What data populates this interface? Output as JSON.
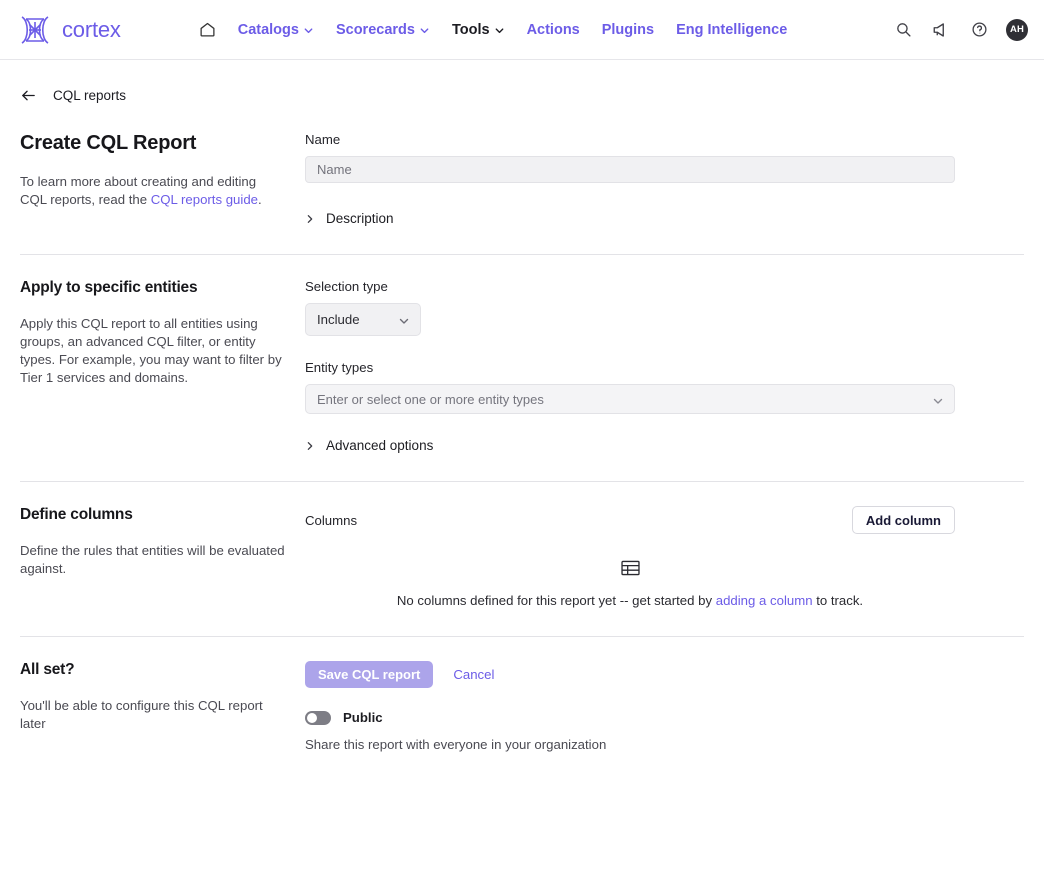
{
  "nav": {
    "brand": "cortex",
    "brand_color": "#6c5ce7",
    "home_icon": "home-icon",
    "links": [
      {
        "label": "Catalogs",
        "has_caret": true,
        "active": false
      },
      {
        "label": "Scorecards",
        "has_caret": true,
        "active": false
      },
      {
        "label": "Tools",
        "has_caret": true,
        "active": true
      },
      {
        "label": "Actions",
        "has_caret": false,
        "active": false
      },
      {
        "label": "Plugins",
        "has_caret": false,
        "active": false
      },
      {
        "label": "Eng Intelligence",
        "has_caret": false,
        "active": false
      }
    ],
    "right_icons": [
      "search-icon",
      "announcement-icon",
      "help-icon"
    ],
    "avatar_initials": "AH"
  },
  "breadcrumb": {
    "back_icon": "arrow-left-icon",
    "label": "CQL reports"
  },
  "sections": {
    "basics": {
      "title": "Create CQL Report",
      "desc_prefix": "To learn more about creating and editing CQL reports, read the ",
      "desc_link": "CQL reports guide",
      "desc_suffix": ".",
      "name_label": "Name",
      "name_value": "",
      "name_placeholder": "Name",
      "description_toggle": "Description"
    },
    "entities": {
      "title": "Apply to specific entities",
      "desc": "Apply this CQL report to all entities using groups, an advanced CQL filter, or entity types. For example, you may want to filter by Tier 1 services and domains.",
      "selection_type_label": "Selection type",
      "selection_type_value": "Include",
      "selection_type_options": [
        "Include"
      ],
      "entity_types_label": "Entity types",
      "entity_types_placeholder": "Enter or select one or more entity types",
      "advanced_toggle": "Advanced options"
    },
    "columns": {
      "title": "Define columns",
      "desc": "Define the rules that entities will be evaluated against.",
      "columns_label": "Columns",
      "add_column_button": "Add column",
      "empty_icon": "table-icon",
      "empty_prefix": "No columns defined for this report yet -- get started by ",
      "empty_link": "adding a column",
      "empty_suffix": " to track."
    },
    "allset": {
      "title": "All set?",
      "desc": "You'll be able to configure this CQL report later",
      "save_button": "Save CQL report",
      "cancel_button": "Cancel",
      "toggle_label": "Public",
      "toggle_state": "off",
      "toggle_help": "Share this report with everyone in your organization"
    }
  },
  "theme": {
    "accent": "#6c5ce7",
    "accent_muted": "#aca4ea",
    "text": "#17171b",
    "muted_text": "#4a4a52",
    "border": "#e3e3e7",
    "field_bg": "#f1f1f3"
  }
}
